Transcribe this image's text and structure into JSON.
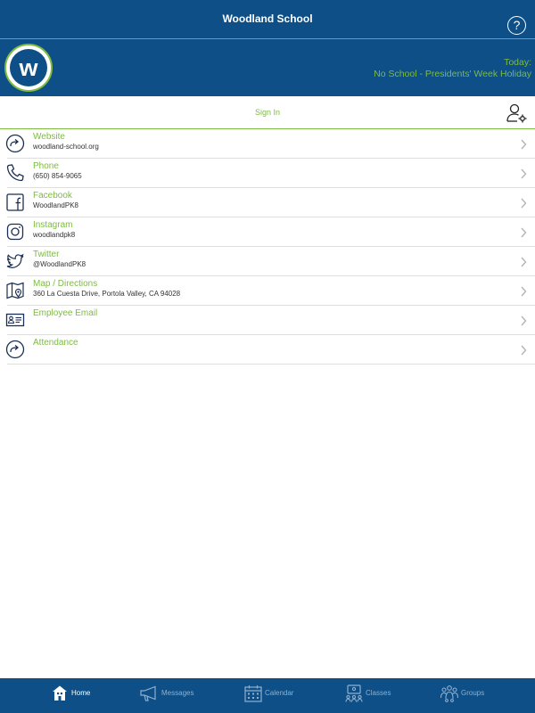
{
  "app": {
    "title": "Woodland School",
    "help_glyph": "?"
  },
  "banner": {
    "logo_letter": "w",
    "today_label": "Today:",
    "today_text": "No School - Presidents' Week Holiday"
  },
  "signin": {
    "label": "Sign In"
  },
  "colors": {
    "brand_blue": "#0d4f86",
    "accent_green": "#7dbb42",
    "inactive_tab": "#8fb0cf"
  },
  "list": [
    {
      "icon": "link-arrow-icon",
      "label": "Website",
      "sub": "woodland-school.org"
    },
    {
      "icon": "phone-icon",
      "label": "Phone",
      "sub": "(650) 854-9065"
    },
    {
      "icon": "facebook-icon",
      "label": "Facebook",
      "sub": "WoodlandPK8"
    },
    {
      "icon": "instagram-icon",
      "label": "Instagram",
      "sub": "woodlandpk8"
    },
    {
      "icon": "twitter-icon",
      "label": "Twitter",
      "sub": "@WoodlandPK8"
    },
    {
      "icon": "map-icon",
      "label": "Map / Directions",
      "sub": "360 La Cuesta Drive, Portola Valley, CA 94028"
    },
    {
      "icon": "id-card-icon",
      "label": "Employee Email",
      "sub": ""
    },
    {
      "icon": "link-arrow-icon",
      "label": "Attendance",
      "sub": ""
    }
  ],
  "tabs": [
    {
      "icon": "home-icon",
      "label": "Home",
      "active": true
    },
    {
      "icon": "megaphone-icon",
      "label": "Messages",
      "active": false
    },
    {
      "icon": "calendar-icon",
      "label": "Calendar",
      "active": false
    },
    {
      "icon": "classes-icon",
      "label": "Classes",
      "active": false
    },
    {
      "icon": "groups-icon",
      "label": "Groups",
      "active": false
    }
  ]
}
